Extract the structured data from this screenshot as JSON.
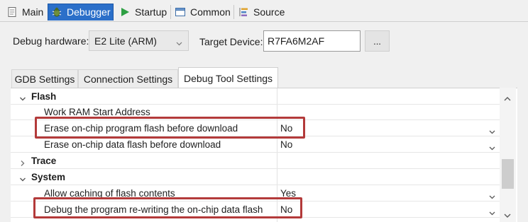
{
  "top_tabs": [
    {
      "label": "Main",
      "icon": "main-tab-icon"
    },
    {
      "label": "Debugger",
      "icon": "debugger-bug-icon",
      "active": true
    },
    {
      "label": "Startup",
      "icon": "play-icon"
    },
    {
      "label": "Common",
      "icon": "common-window-icon"
    },
    {
      "label": "Source",
      "icon": "source-lookup-icon"
    }
  ],
  "debug_hardware": {
    "label": "Debug hardware:",
    "value": "E2 Lite (ARM)"
  },
  "target_device": {
    "label": "Target Device:",
    "value": "R7FA6M2AF",
    "browse_label": "..."
  },
  "sub_tabs": [
    {
      "label": "GDB Settings"
    },
    {
      "label": "Connection Settings"
    },
    {
      "label": "Debug Tool Settings",
      "active": true
    }
  ],
  "rows": [
    {
      "name": "Flash",
      "group": true,
      "expanded": true,
      "value": ""
    },
    {
      "name": "Work RAM Start Address",
      "value": ""
    },
    {
      "name": "Erase on-chip program flash before download",
      "value": "No",
      "dropdown": true,
      "highlighted": true
    },
    {
      "name": "Erase on-chip data flash before download",
      "value": "No",
      "dropdown": true
    },
    {
      "name": "Trace",
      "group": true,
      "expanded": false,
      "value": ""
    },
    {
      "name": "System",
      "group": true,
      "expanded": true,
      "value": ""
    },
    {
      "name": "Allow caching of flash contents",
      "value": "Yes",
      "dropdown": true
    },
    {
      "name": "Debug the program re-writing the on-chip data flash",
      "value": "No",
      "dropdown": true,
      "highlighted": true
    }
  ],
  "colors": {
    "active_tab_bg": "#2b6fc9",
    "highlight_border": "#b33a3a",
    "play_green": "#2ea043"
  }
}
